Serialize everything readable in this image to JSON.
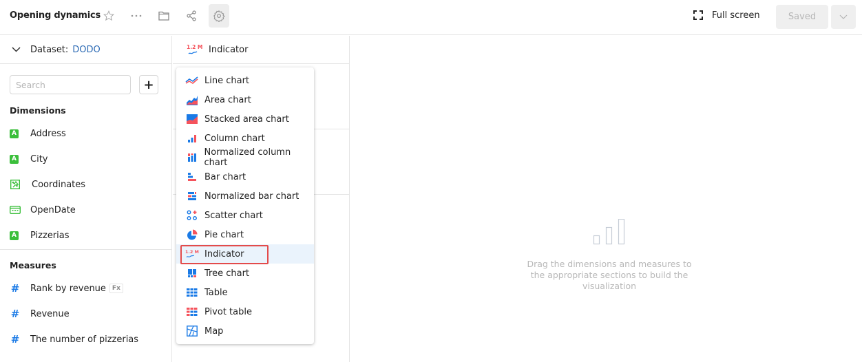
{
  "header": {
    "title": "Opening dynamics",
    "icons": [
      "star-icon",
      "more-icon",
      "folder-icon",
      "share-icon",
      "settings-icon"
    ],
    "fullscreen_label": "Full screen",
    "saved_label": "Saved"
  },
  "dataset": {
    "label": "Dataset:",
    "name": "DODO"
  },
  "search": {
    "placeholder": "Search",
    "value": "",
    "add_label": "+"
  },
  "dimensions": {
    "title": "Dimensions",
    "items": [
      {
        "label": "Address",
        "type": "string"
      },
      {
        "label": "City",
        "type": "string"
      },
      {
        "label": "Coordinates",
        "type": "geo"
      },
      {
        "label": "OpenDate",
        "type": "date"
      },
      {
        "label": "Pizzerias",
        "type": "string"
      }
    ]
  },
  "measures": {
    "title": "Measures",
    "items": [
      {
        "label": "Rank by revenue",
        "badge": "Fx"
      },
      {
        "label": "Revenue"
      },
      {
        "label": "The number of pizzerias"
      }
    ]
  },
  "visualization": {
    "current": "Indicator",
    "icon_text": "1.2 M",
    "options": [
      {
        "label": "Line chart",
        "icon": "line-chart-icon"
      },
      {
        "label": "Area chart",
        "icon": "area-chart-icon"
      },
      {
        "label": "Stacked area chart",
        "icon": "stacked-area-chart-icon"
      },
      {
        "label": "Column chart",
        "icon": "column-chart-icon"
      },
      {
        "label": "Normalized column chart",
        "icon": "normalized-column-chart-icon"
      },
      {
        "label": "Bar chart",
        "icon": "bar-chart-icon"
      },
      {
        "label": "Normalized bar chart",
        "icon": "normalized-bar-chart-icon"
      },
      {
        "label": "Scatter chart",
        "icon": "scatter-chart-icon"
      },
      {
        "label": "Pie chart",
        "icon": "pie-chart-icon"
      },
      {
        "label": "Indicator",
        "icon": "indicator-icon",
        "selected": true
      },
      {
        "label": "Tree chart",
        "icon": "tree-chart-icon"
      },
      {
        "label": "Table",
        "icon": "table-icon"
      },
      {
        "label": "Pivot table",
        "icon": "pivot-table-icon"
      },
      {
        "label": "Map",
        "icon": "map-icon"
      }
    ]
  },
  "placeholder": {
    "text": "Drag the dimensions and measures to the appropriate sections to build the visualization"
  },
  "colors": {
    "blue": "#1a7ae6",
    "red": "#f5535c",
    "green": "#3bbf3b",
    "link": "#2d6bb5",
    "selected_outline": "#e34b4b"
  }
}
